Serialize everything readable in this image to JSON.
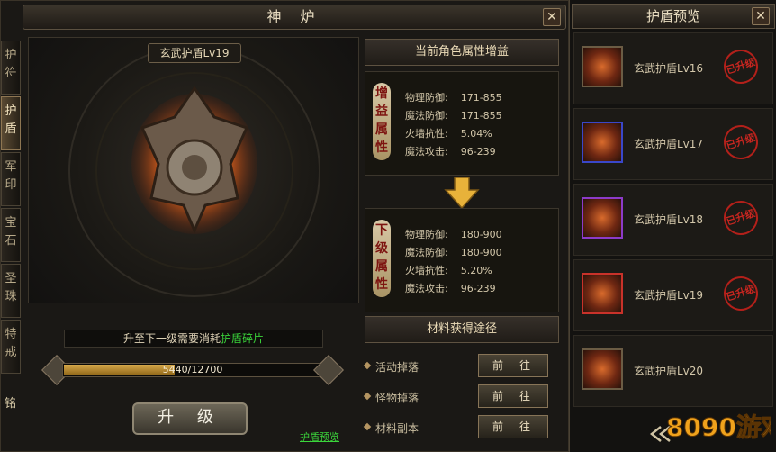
{
  "window": {
    "title": "神 炉",
    "close_label": "✕"
  },
  "side_tabs": [
    {
      "label": "护符",
      "active": false
    },
    {
      "label": "护盾",
      "active": true
    },
    {
      "label": "军印",
      "active": false
    },
    {
      "label": "宝石",
      "active": false
    },
    {
      "label": "圣珠",
      "active": false
    },
    {
      "label": "特戒",
      "active": false
    }
  ],
  "side_tab_extra": "铭",
  "shield": {
    "name": "玄武护盾Lv19"
  },
  "current": {
    "header": "当前角色属性增益",
    "tag": "增益属性",
    "stats": [
      {
        "label": "物理防御:",
        "value": "171-855"
      },
      {
        "label": "魔法防御:",
        "value": "171-855"
      },
      {
        "label": "火墙抗性:",
        "value": "5.04%"
      },
      {
        "label": "魔法攻击:",
        "value": "96-239"
      }
    ]
  },
  "next": {
    "tag": "下级属性",
    "stats": [
      {
        "label": "物理防御:",
        "value": "180-900"
      },
      {
        "label": "魔法防御:",
        "value": "180-900"
      },
      {
        "label": "火墙抗性:",
        "value": "5.20%"
      },
      {
        "label": "魔法攻击:",
        "value": "96-239"
      }
    ]
  },
  "requirement": {
    "prefix": "升至下一级需要消耗",
    "item": "护盾碎片"
  },
  "progress": {
    "text": "5440/12700",
    "current": 5440,
    "max": 12700
  },
  "upgrade_label": "升 级",
  "preview_link": "护盾预览",
  "sources": {
    "header": "材料获得途径",
    "items": [
      {
        "label": "活动掉落",
        "button": "前往"
      },
      {
        "label": "怪物掉落",
        "button": "前往"
      },
      {
        "label": "材料副本",
        "button": "前往"
      }
    ]
  },
  "preview": {
    "title": "护盾预览",
    "close_label": "✕",
    "items": [
      {
        "name": "玄武护盾Lv16",
        "status": "已升级",
        "border": "#6b5c44"
      },
      {
        "name": "玄武护盾Lv17",
        "status": "已升级",
        "border": "#3a47c9"
      },
      {
        "name": "玄武护盾Lv18",
        "status": "已升级",
        "border": "#8c3bc9"
      },
      {
        "name": "玄武护盾Lv19",
        "status": "已升级",
        "border": "#c9322a"
      },
      {
        "name": "玄武护盾Lv20",
        "status": "",
        "border": "#6b5c44"
      }
    ]
  },
  "logo": {
    "text": "8090游戏"
  },
  "colors": {
    "accent_green": "#3ad23a",
    "stamp_red": "#c72620",
    "gold": "#d7a94a"
  }
}
